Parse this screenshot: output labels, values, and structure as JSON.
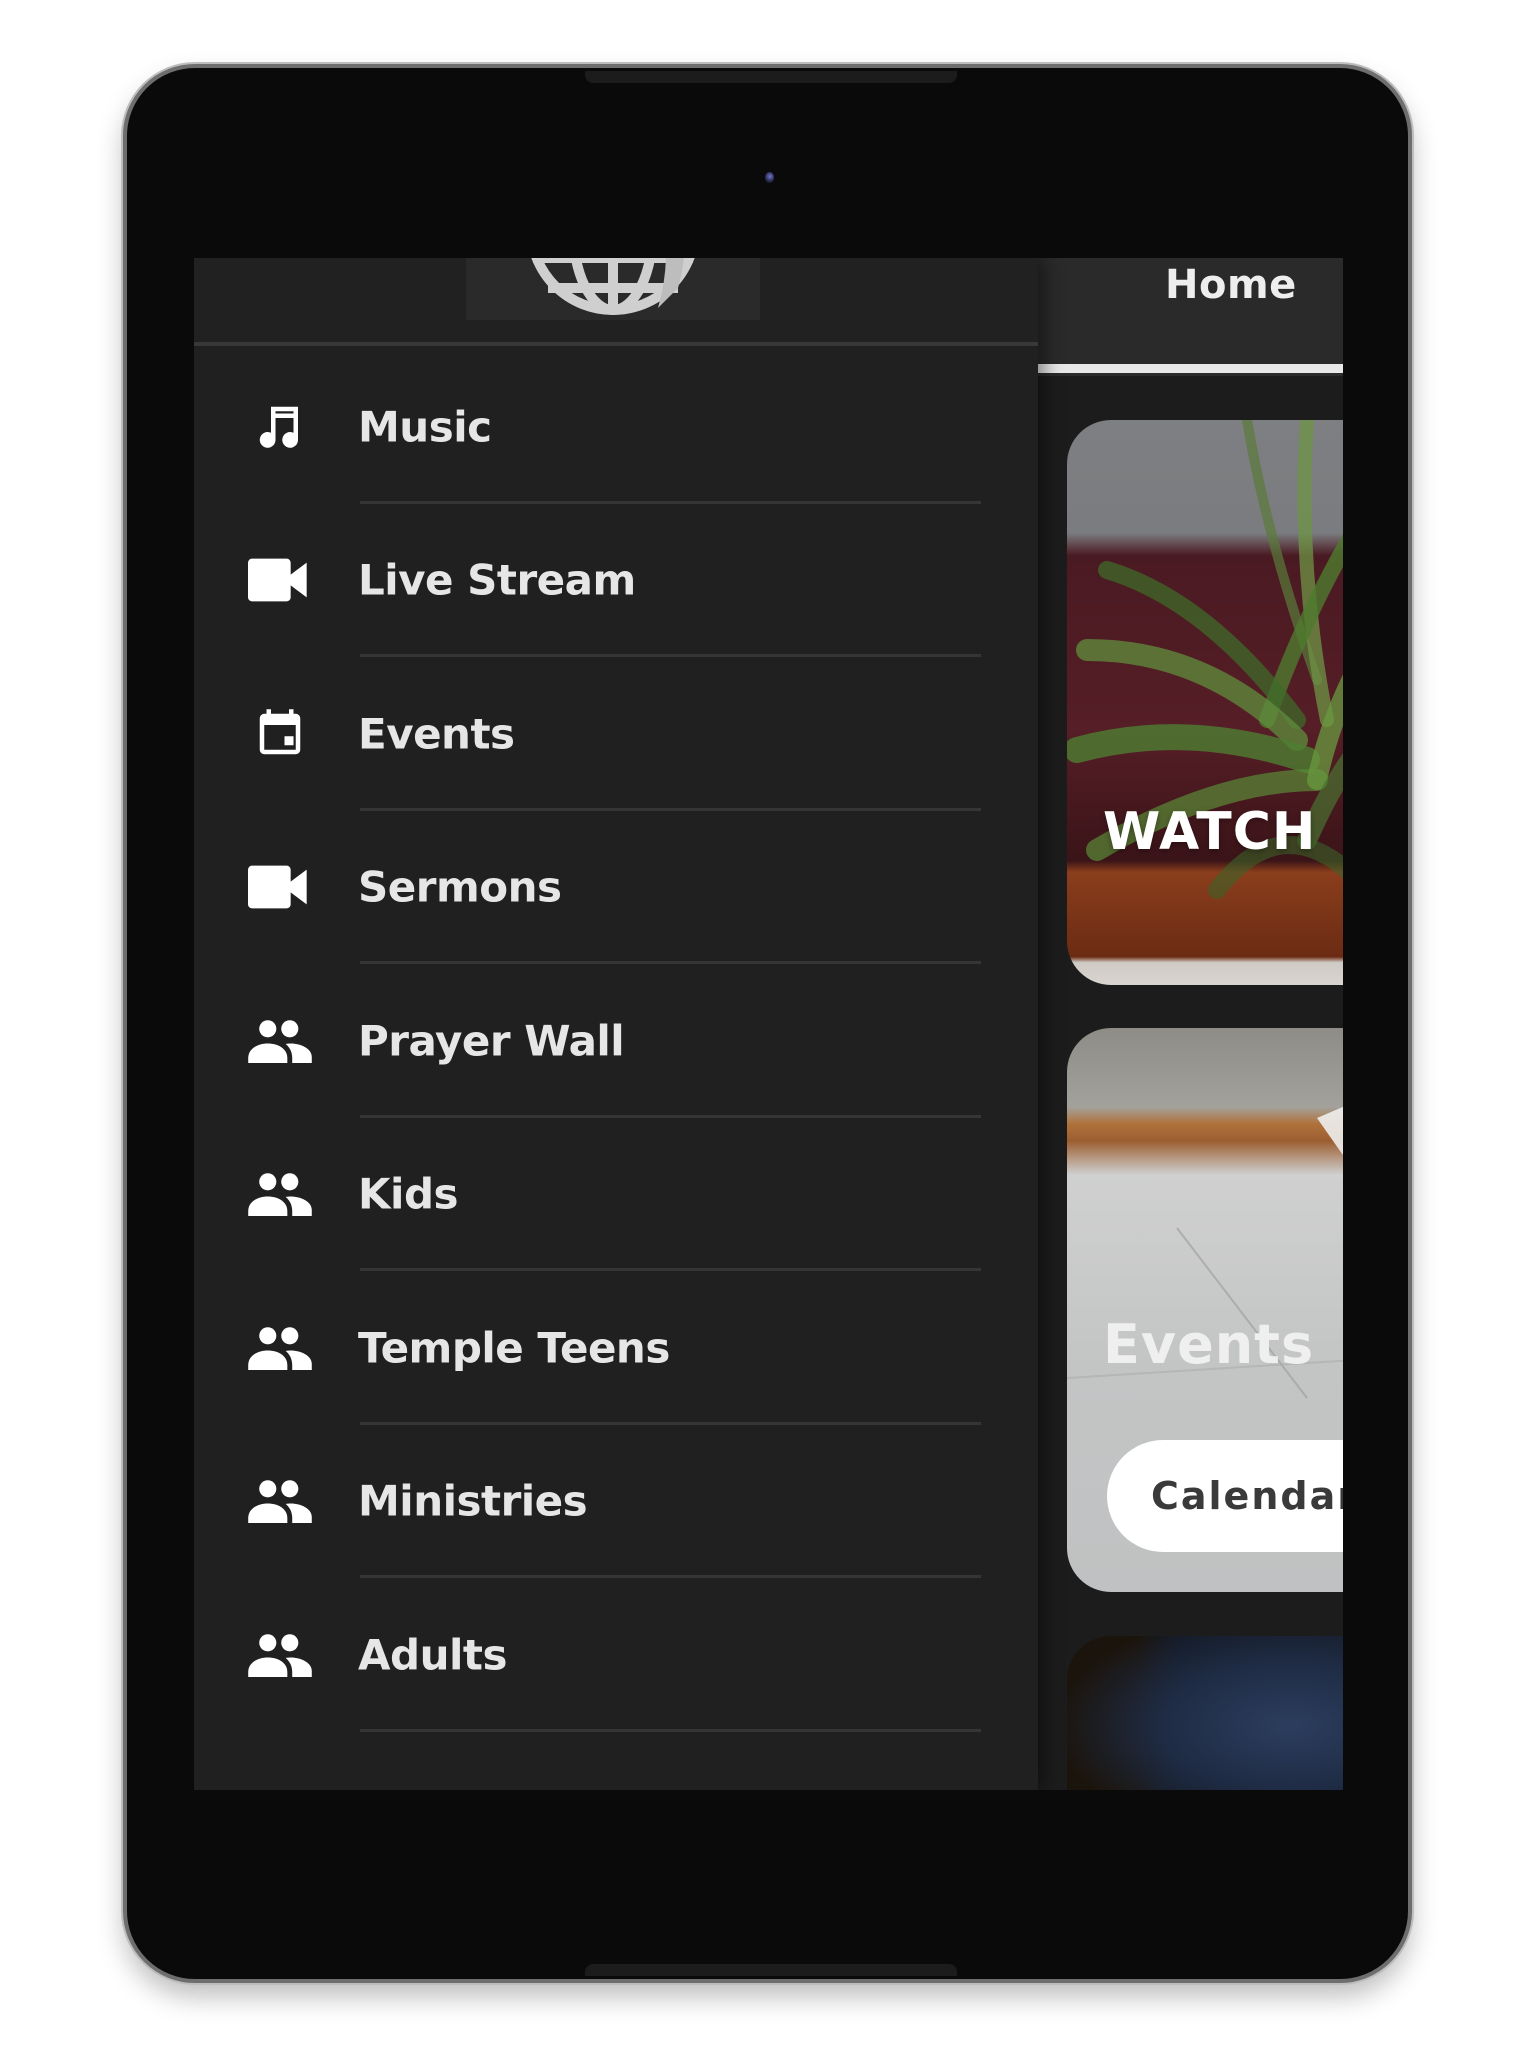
{
  "device": {
    "type": "tablet",
    "orientation": "portrait"
  },
  "drawer": {
    "logo": "globe-logo",
    "items": [
      {
        "label": "Music",
        "icon": "music-note-icon"
      },
      {
        "label": "Live Stream",
        "icon": "videocam-icon"
      },
      {
        "label": "Events",
        "icon": "calendar-event-icon"
      },
      {
        "label": "Sermons",
        "icon": "videocam-icon"
      },
      {
        "label": "Prayer Wall",
        "icon": "people-icon"
      },
      {
        "label": "Kids",
        "icon": "people-icon"
      },
      {
        "label": "Temple Teens",
        "icon": "people-icon"
      },
      {
        "label": "Ministries",
        "icon": "people-icon"
      },
      {
        "label": "Adults",
        "icon": "people-icon"
      }
    ]
  },
  "main": {
    "tabs": [
      {
        "label": "Home",
        "active": true
      }
    ],
    "cards": [
      {
        "title": "WATCH"
      },
      {
        "title": "Events",
        "button_label": "Calendar"
      },
      {
        "title": ""
      }
    ]
  },
  "colors": {
    "drawer_bg": "#202020",
    "text": "#e6e6e6",
    "divider": "#353535",
    "tab_indicator": "#e8e8e8"
  }
}
